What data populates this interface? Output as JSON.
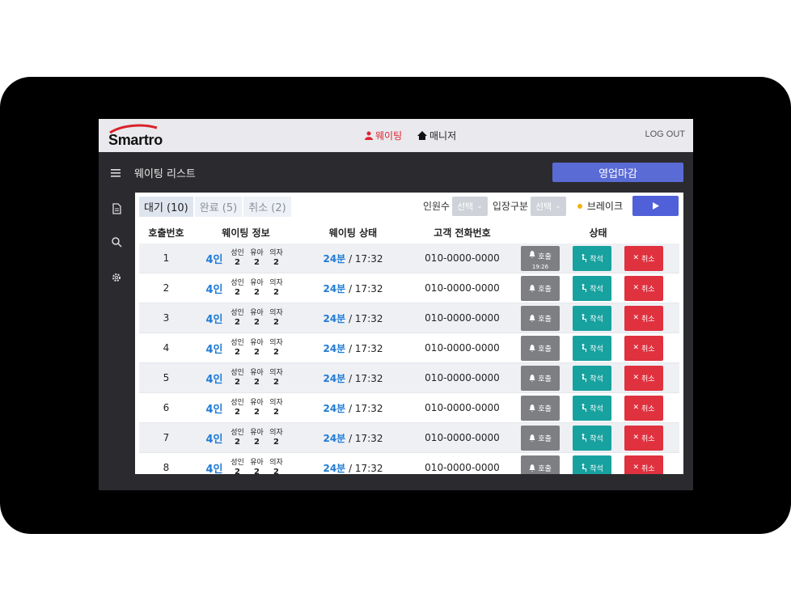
{
  "app": {
    "brand": "Smartro",
    "logout": "LOG OUT"
  },
  "nav": {
    "waiting": "웨이팅",
    "manager": "매니저"
  },
  "header": {
    "title": "웨이팅 리스트",
    "close_button": "영업마감"
  },
  "tabs": [
    {
      "label": "대기 (10)",
      "active": true
    },
    {
      "label": "완료 (5)",
      "active": false
    },
    {
      "label": "취소 (2)",
      "active": false
    }
  ],
  "filters": {
    "people_label": "인원수",
    "people_value": "선택",
    "entry_label": "입장구분",
    "entry_value": "선택",
    "break_label": "브레이크"
  },
  "columns": {
    "number": "호출번호",
    "info": "웨이팅 정보",
    "state": "웨이팅 상태",
    "phone": "고객 전화번호",
    "status": "상태"
  },
  "labels": {
    "adult": "성인",
    "infant": "유아",
    "chair": "의자",
    "call": "호출",
    "seat": "착석",
    "cancel": "취소"
  },
  "rows": [
    {
      "num": "1",
      "people": "4인",
      "adult": "2",
      "infant": "2",
      "chair": "2",
      "wait": "24분",
      "time": "/ 17:32",
      "phone": "010-0000-0000",
      "call_time": "19:26"
    },
    {
      "num": "2",
      "people": "4인",
      "adult": "2",
      "infant": "2",
      "chair": "2",
      "wait": "24분",
      "time": "/ 17:32",
      "phone": "010-0000-0000"
    },
    {
      "num": "3",
      "people": "4인",
      "adult": "2",
      "infant": "2",
      "chair": "2",
      "wait": "24분",
      "time": "/ 17:32",
      "phone": "010-0000-0000"
    },
    {
      "num": "4",
      "people": "4인",
      "adult": "2",
      "infant": "2",
      "chair": "2",
      "wait": "24분",
      "time": "/ 17:32",
      "phone": "010-0000-0000"
    },
    {
      "num": "5",
      "people": "4인",
      "adult": "2",
      "infant": "2",
      "chair": "2",
      "wait": "24분",
      "time": "/ 17:32",
      "phone": "010-0000-0000"
    },
    {
      "num": "6",
      "people": "4인",
      "adult": "2",
      "infant": "2",
      "chair": "2",
      "wait": "24분",
      "time": "/ 17:32",
      "phone": "010-0000-0000"
    },
    {
      "num": "7",
      "people": "4인",
      "adult": "2",
      "infant": "2",
      "chair": "2",
      "wait": "24분",
      "time": "/ 17:32",
      "phone": "010-0000-0000"
    },
    {
      "num": "8",
      "people": "4인",
      "adult": "2",
      "infant": "2",
      "chair": "2",
      "wait": "24분",
      "time": "/ 17:32",
      "phone": "010-0000-0000"
    }
  ],
  "colors": {
    "accent": "#5b6bd6",
    "call": "#7e7f82",
    "seat": "#17a2a0",
    "cancel": "#e0313f",
    "link": "#1f7bd6",
    "brand_red": "#e0242f"
  }
}
